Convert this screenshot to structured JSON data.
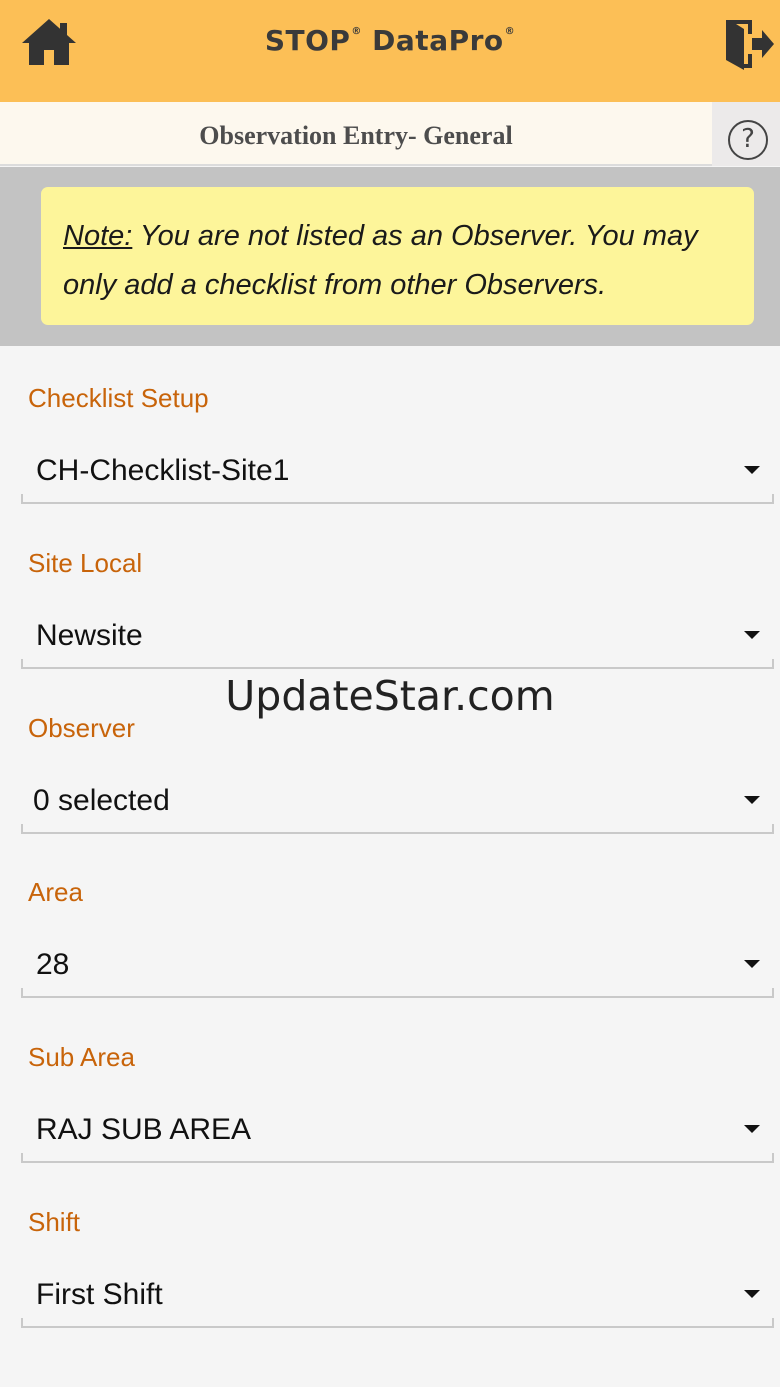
{
  "app": {
    "brand_name": "STOP",
    "brand_suffix": "DataPro",
    "brand_mark": "®"
  },
  "icons": {
    "home": "home-icon",
    "logout": "logout-icon",
    "help": "help-icon"
  },
  "colors": {
    "topbar": "#fcbf56",
    "note_background": "#fdf59a",
    "label_accent": "#c8640a"
  },
  "header": {
    "title": "Observation Entry- General",
    "help_glyph": "?"
  },
  "note": {
    "lead": "Note:",
    "text": " You are not listed as an Observer. You may only add a checklist from other Observers."
  },
  "form": {
    "fields": [
      {
        "label": "Checklist Setup",
        "value": "CH-Checklist-Site1"
      },
      {
        "label": "Site Local",
        "value": "Newsite"
      },
      {
        "label": "Observer",
        "value": "0 selected"
      },
      {
        "label": "Area",
        "value": "28"
      },
      {
        "label": "Sub Area",
        "value": "RAJ SUB AREA"
      },
      {
        "label": "Shift",
        "value": "First Shift"
      }
    ]
  },
  "watermark": "UpdateStar.com"
}
